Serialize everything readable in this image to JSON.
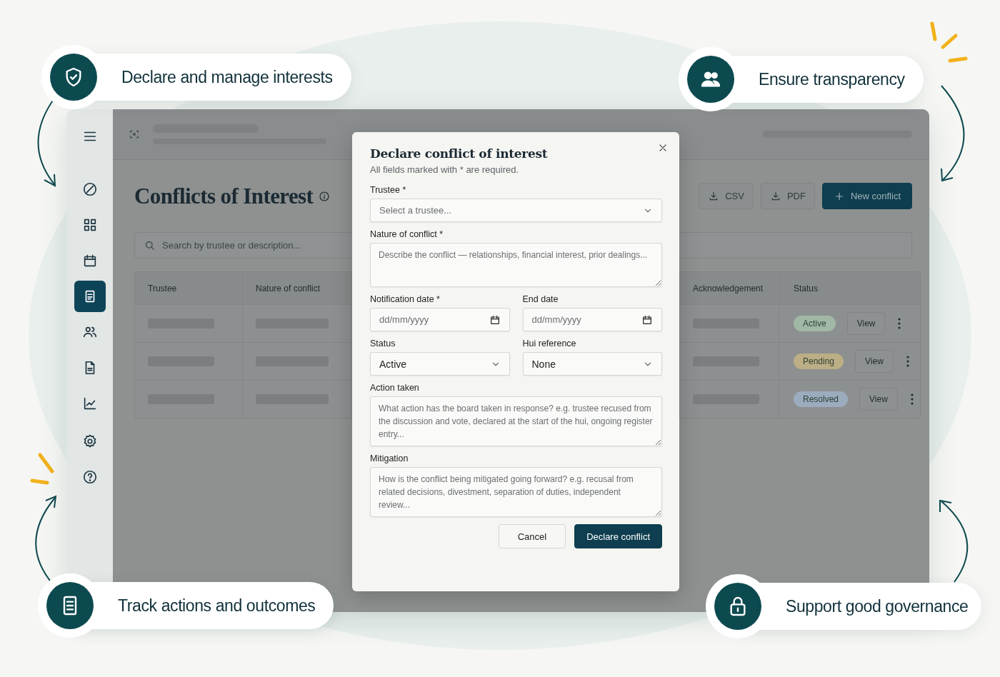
{
  "callouts": [
    {
      "text": "Declare and manage interests"
    },
    {
      "text": "Ensure transparency"
    },
    {
      "text": "Track actions and outcomes"
    },
    {
      "text": "Support good governance"
    }
  ],
  "sidebar": {
    "items": [
      {
        "selected": false
      },
      {
        "selected": false
      },
      {
        "selected": false
      },
      {
        "selected": true
      },
      {
        "selected": false
      },
      {
        "selected": false
      },
      {
        "selected": false
      },
      {
        "selected": false
      },
      {
        "selected": false
      }
    ]
  },
  "page": {
    "title": "Conflicts of Interest",
    "buttons": [
      {
        "label": "CSV",
        "kind": "export"
      },
      {
        "label": "PDF",
        "kind": "export"
      },
      {
        "label": "New conflict",
        "kind": "primary"
      }
    ],
    "search": {
      "placeholder": "Search by trustee or description..."
    }
  },
  "table": {
    "columns": [
      "Trustee",
      "Nature of conflict",
      "Acknowledgement",
      "Status"
    ],
    "rows": [
      {
        "status": "Active",
        "color": "#a2b8a7",
        "action": "View"
      },
      {
        "status": "Pending",
        "color": "#bcae85",
        "action": "View"
      },
      {
        "status": "Resolved",
        "color": "#9aacbd",
        "action": "View"
      }
    ]
  },
  "dialog": {
    "title": "Declare conflict of interest",
    "subtitle": "All fields marked with * are required.",
    "rows": [
      [
        {
          "kind": "select",
          "label": "Trustee *",
          "placeholder": "Select a trustee..."
        }
      ],
      [
        {
          "kind": "textarea",
          "label": "Nature of conflict *",
          "placeholder": "Describe the conflict — relationships, financial interest, prior dealings..."
        }
      ],
      [
        {
          "kind": "date",
          "label": "Notification date *",
          "placeholder": "dd/mm/yyyy"
        },
        {
          "kind": "date",
          "label": "End date",
          "placeholder": "dd/mm/yyyy"
        }
      ],
      [
        {
          "kind": "select",
          "label": "Status",
          "value": "Active"
        },
        {
          "kind": "select",
          "label": "Hui reference",
          "value": "None"
        }
      ],
      [
        {
          "kind": "textarea",
          "label": "Action taken",
          "placeholder": "What action has the board taken in response? e.g. trustee recused from the discussion and vote, declared at the start of the hui, ongoing register entry..."
        }
      ],
      [
        {
          "kind": "textarea",
          "label": "Mitigation",
          "placeholder": "How is the conflict being mitigated going forward? e.g. recusal from related decisions, divestment, separation of duties, independent review..."
        }
      ]
    ],
    "buttons": [
      {
        "label": "Cancel",
        "kind": "secondary"
      },
      {
        "label": "Declare conflict",
        "kind": "primary"
      }
    ]
  }
}
